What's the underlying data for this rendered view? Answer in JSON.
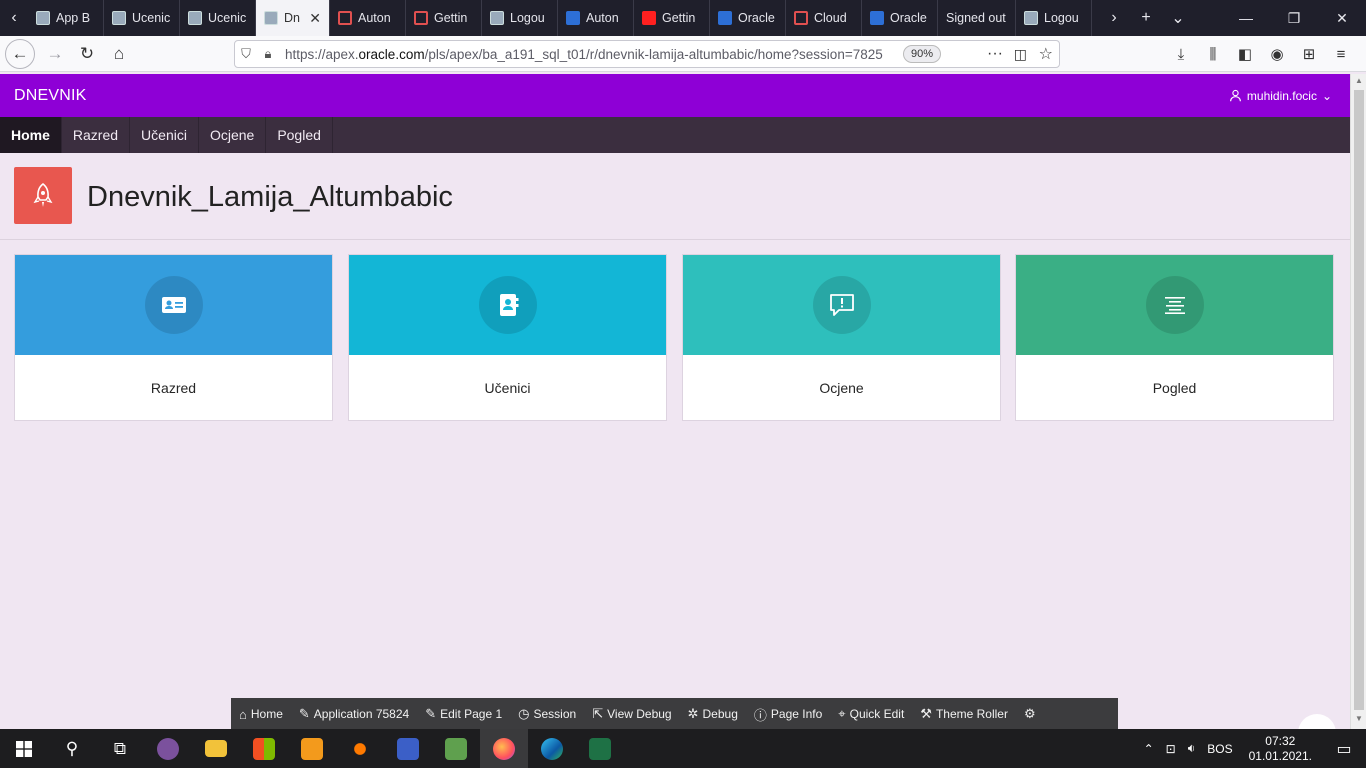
{
  "browser": {
    "tabs": [
      {
        "label": "App B",
        "favicon": "apex-icon"
      },
      {
        "label": "Ucenic",
        "favicon": "apex-icon"
      },
      {
        "label": "Ucenic",
        "favicon": "apex-icon"
      },
      {
        "label": "Dn",
        "favicon": "apex-icon",
        "active": true
      },
      {
        "label": "Auton",
        "favicon": "oracle-ring-icon"
      },
      {
        "label": "Gettin",
        "favicon": "oracle-ring-icon"
      },
      {
        "label": "Logou",
        "favicon": "apex-icon"
      },
      {
        "label": "Auton",
        "favicon": "cloud-icon"
      },
      {
        "label": "Gettin",
        "favicon": "youtube-icon"
      },
      {
        "label": "Oracle",
        "favicon": "cloud-icon"
      },
      {
        "label": "Cloud",
        "favicon": "oracle-ring-icon"
      },
      {
        "label": "Oracle",
        "favicon": "cloud-icon"
      },
      {
        "label": "Signed out",
        "favicon": ""
      },
      {
        "label": "Logou",
        "favicon": "apex-icon"
      }
    ],
    "url_prefix": "https://apex.",
    "url_domain": "oracle.com",
    "url_path": "/pls/apex/ba_a191_sql_t01/r/dnevnik-lamija-altumbabic/home?session=7825",
    "zoom": "90%"
  },
  "app": {
    "brand": "DNEVNIK",
    "user": "muhidin.focic",
    "accent": "#8e00d6",
    "menu": [
      {
        "label": "Home",
        "active": true
      },
      {
        "label": "Razred"
      },
      {
        "label": "Učenici"
      },
      {
        "label": "Ocjene"
      },
      {
        "label": "Pogled"
      }
    ],
    "page_title": "Dnevnik_Lamija_Altumbabic",
    "cards": [
      {
        "label": "Razred",
        "color": "#349ddd",
        "icon": "id-card-icon"
      },
      {
        "label": "Učenici",
        "color": "#13b6d6",
        "icon": "address-book-icon"
      },
      {
        "label": "Ocjene",
        "color": "#2ebfbc",
        "icon": "comment-alert-icon"
      },
      {
        "label": "Pogled",
        "color": "#3aaf85",
        "icon": "align-center-icon"
      }
    ]
  },
  "devbar": [
    {
      "label": "Home",
      "icon": "home-icon"
    },
    {
      "label": "Application 75824",
      "icon": "edit-icon"
    },
    {
      "label": "Edit Page 1",
      "icon": "edit-page-icon"
    },
    {
      "label": "Session",
      "icon": "clock-icon"
    },
    {
      "label": "View Debug",
      "icon": "external-link-icon"
    },
    {
      "label": "Debug",
      "icon": "bug-icon"
    },
    {
      "label": "Page Info",
      "icon": "info-icon"
    },
    {
      "label": "Quick Edit",
      "icon": "cursor-icon"
    },
    {
      "label": "Theme Roller",
      "icon": "paint-roller-icon"
    }
  ],
  "taskbar": {
    "language": "BOS",
    "time": "07:32",
    "date": "01.01.2021."
  }
}
